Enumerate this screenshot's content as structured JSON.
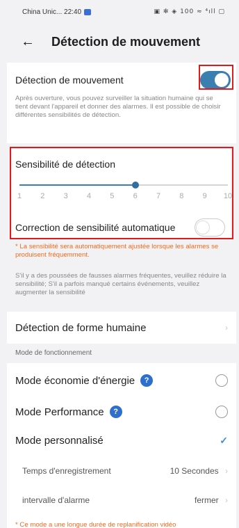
{
  "status_bar": {
    "carrier_time": "China Unic... 22:40",
    "right_icons": "▣ ✻ ◈ 100 ≈ ⁴ıll ▢"
  },
  "header": {
    "back_icon": "←",
    "title": "Détection de mouvement"
  },
  "motion": {
    "label": "Détection de mouvement",
    "enabled": true,
    "description": "Après ouverture, vous pouvez surveiller la situation humaine qui se tient devant l'appareil et donner des alarmes. Il est possible de choisir différentes sensibilités de détection."
  },
  "sensitivity": {
    "label": "Sensibilité de détection",
    "value": 6,
    "ticks": [
      "1",
      "2",
      "3",
      "4",
      "5",
      "6",
      "7",
      "8",
      "9",
      "10"
    ],
    "auto_label": "Correction de sensibilité automatique",
    "auto_enabled": false,
    "warning": "* La sensibilité sera automatiquement ajustée lorsque les alarmes se produisent fréquemment.",
    "advice": "S'il y a des poussées de fausses alarmes fréquentes, veuillez réduire la sensibilité; S'il a parfois manqué certains événements, veuillez augmenter la sensibilité"
  },
  "human": {
    "label": "Détection de forme humaine",
    "chevron": "›"
  },
  "modes": {
    "section_label": "Mode de fonctionnement",
    "eco_label": "Mode économie d'énergie",
    "perf_label": "Mode Performance",
    "custom_label": "Mode personnalisé",
    "help_icon": "?",
    "check_icon": "✓",
    "selected": "custom"
  },
  "custom": {
    "record_label": "Temps d'enregistrement",
    "record_value": "10 Secondes",
    "interval_label": "intervalle d'alarme",
    "interval_value": "fermer",
    "footer_warning": "* Ce mode a une longue durée de replanification vidéo"
  },
  "colors": {
    "accent": "#3b7fb0",
    "warning": "#ef6d1f",
    "highlight": "#e0191c",
    "help": "#2e6fcc"
  }
}
